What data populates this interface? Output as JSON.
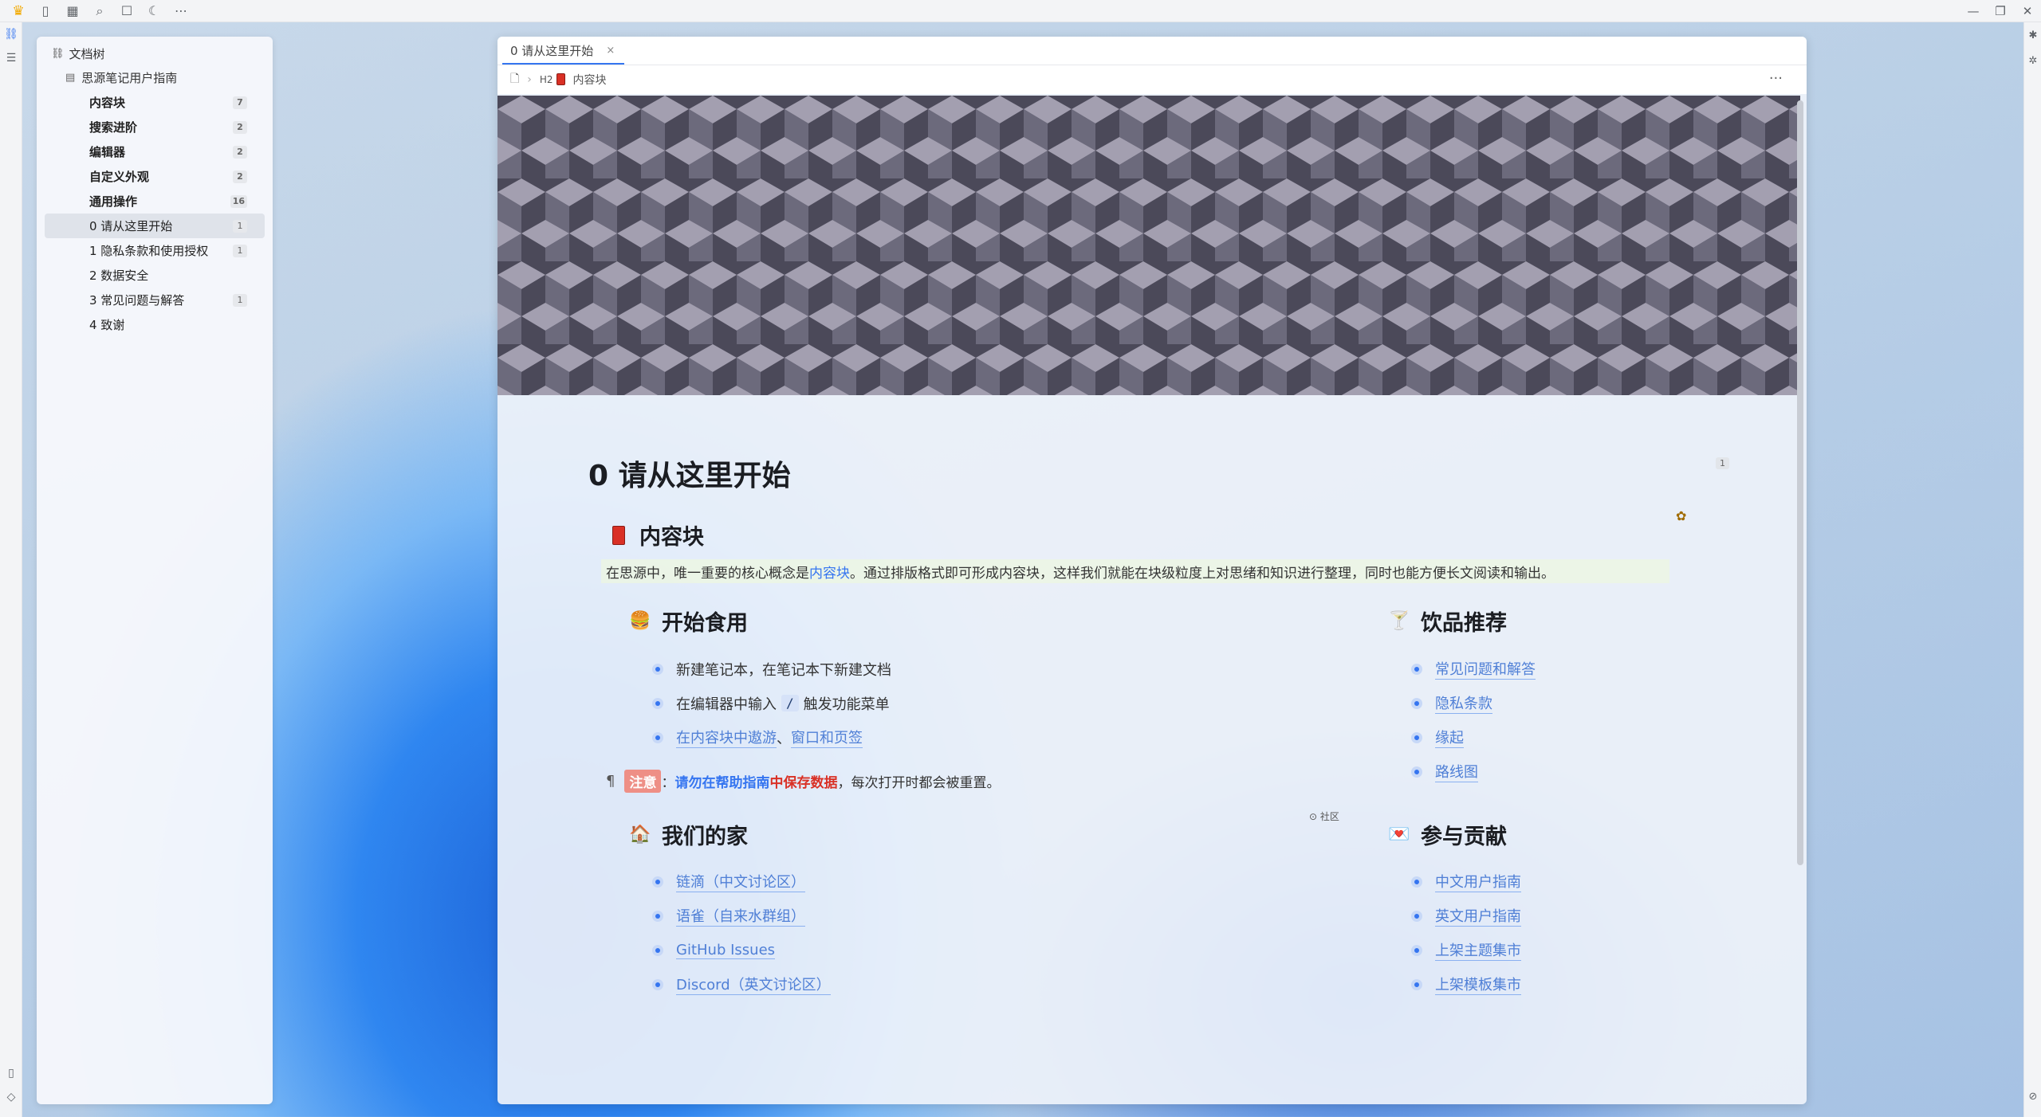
{
  "tree": {
    "header": "文档树",
    "notebook": "思源笔记用户指南",
    "items": [
      {
        "label": "内容块",
        "count": "7",
        "bold": true
      },
      {
        "label": "搜索进阶",
        "count": "2",
        "bold": true
      },
      {
        "label": "编辑器",
        "count": "2",
        "bold": true
      },
      {
        "label": "自定义外观",
        "count": "2",
        "bold": true
      },
      {
        "label": "通用操作",
        "count": "16",
        "bold": true
      },
      {
        "label": "0 请从这里开始",
        "count": "1",
        "active": true
      },
      {
        "label": "1 隐私条款和使用授权",
        "count": "1"
      },
      {
        "label": "2 数据安全",
        "count": ""
      },
      {
        "label": "3 常见问题与解答",
        "count": "1"
      },
      {
        "label": "4 致谢",
        "count": ""
      }
    ]
  },
  "tab": {
    "label": "0 请从这里开始",
    "close": "×"
  },
  "breadcrumb": {
    "h2": "H2",
    "label": "内容块",
    "more": "···"
  },
  "doc": {
    "title": "0 请从这里开始",
    "ref_count": "1",
    "h_blocks": "内容块",
    "intro_pre": "在思源中，唯一重要的核心概念是",
    "intro_link": "内容块",
    "intro_post": "。通过排版格式即可形成内容块，这样我们就能在块级粒度上对思绪和知识进行整理，同时也能方便长文阅读和输出。",
    "h_start": "开始食用",
    "start_items": {
      "i1": "新建笔记本，在笔记本下新建文档",
      "i2_pre": "在编辑器中输入",
      "i2_kbd": "/",
      "i2_post": "触发功能菜单",
      "i3_a": "在内容块中遨游",
      "i3_sep": "、",
      "i3_b": "窗口和页签"
    },
    "note": {
      "pilcrow": "¶",
      "tag": "注意",
      "colon": "：",
      "blue": "请勿在帮助指南",
      "red": "中保存数据",
      "rest": "，每次打开时都会被重置。"
    },
    "community": "⊙ 社区",
    "h_drinks": "饮品推荐",
    "drinks": [
      "常见问题和解答",
      "隐私条款",
      "缘起",
      "路线图"
    ],
    "h_home": "我们的家",
    "home": [
      "链滴（中文讨论区）",
      "语雀（自来水群组）",
      "GitHub Issues",
      "Discord（英文讨论区）"
    ],
    "h_contrib": "参与贡献",
    "contrib": [
      "中文用户指南",
      "英文用户指南",
      "上架主题集市",
      "上架模板集市"
    ]
  },
  "colors": {
    "accent": "#3575f0",
    "warning": "#d93025",
    "cover_dark": "#4a4858",
    "cover_light": "#9c98a8"
  }
}
